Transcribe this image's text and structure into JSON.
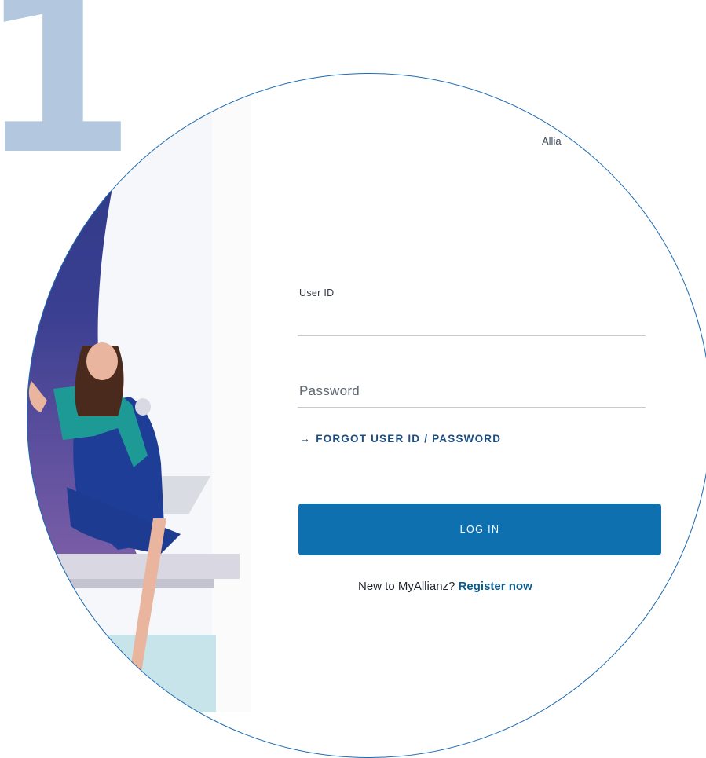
{
  "step_number": "1",
  "brand_text": "Allia",
  "login_form": {
    "user_id_label": "User ID",
    "user_id_value": "",
    "password_placeholder": "Password",
    "forgot_link_label": "FORGOT USER ID / PASSWORD",
    "forgot_arrow_icon": "arrow-right-icon",
    "login_button_label": "LOG IN"
  },
  "register": {
    "prompt": "New to MyAllianz?",
    "link_label": "Register now"
  },
  "colors": {
    "step_number": "#b3c8de",
    "circle_outline": "#1d6ab1",
    "button": "#0f70af",
    "link": "#1b4e82",
    "illustration_blue": "#2e3d8a",
    "illustration_purple": "#6b57a0"
  }
}
